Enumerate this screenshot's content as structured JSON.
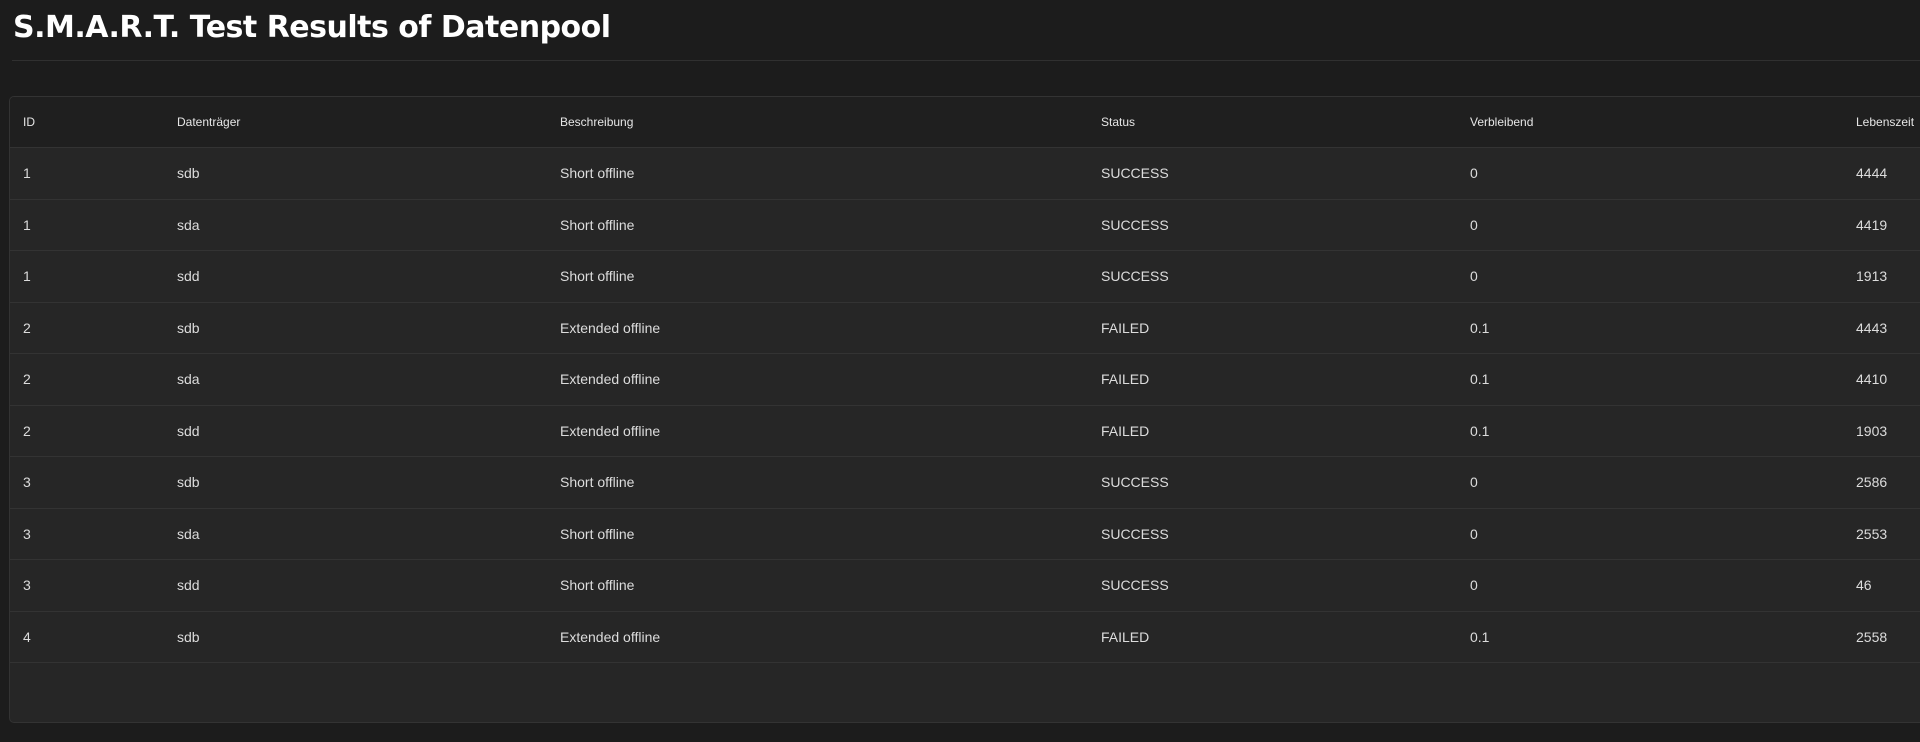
{
  "page": {
    "title": "S.M.A.R.T. Test Results of Datenpool"
  },
  "table": {
    "columns": [
      "ID",
      "Datenträger",
      "Beschreibung",
      "Status",
      "Verbleibend",
      "Lebenszeit"
    ],
    "rows": [
      [
        "1",
        "sdb",
        "Short offline",
        "SUCCESS",
        "0",
        "4444"
      ],
      [
        "1",
        "sda",
        "Short offline",
        "SUCCESS",
        "0",
        "4419"
      ],
      [
        "1",
        "sdd",
        "Short offline",
        "SUCCESS",
        "0",
        "1913"
      ],
      [
        "2",
        "sdb",
        "Extended offline",
        "FAILED",
        "0.1",
        "4443"
      ],
      [
        "2",
        "sda",
        "Extended offline",
        "FAILED",
        "0.1",
        "4410"
      ],
      [
        "2",
        "sdd",
        "Extended offline",
        "FAILED",
        "0.1",
        "1903"
      ],
      [
        "3",
        "sdb",
        "Short offline",
        "SUCCESS",
        "0",
        "2586"
      ],
      [
        "3",
        "sda",
        "Short offline",
        "SUCCESS",
        "0",
        "2553"
      ],
      [
        "3",
        "sdd",
        "Short offline",
        "SUCCESS",
        "0",
        "46"
      ],
      [
        "4",
        "sdb",
        "Extended offline",
        "FAILED",
        "0.1",
        "2558"
      ]
    ]
  }
}
